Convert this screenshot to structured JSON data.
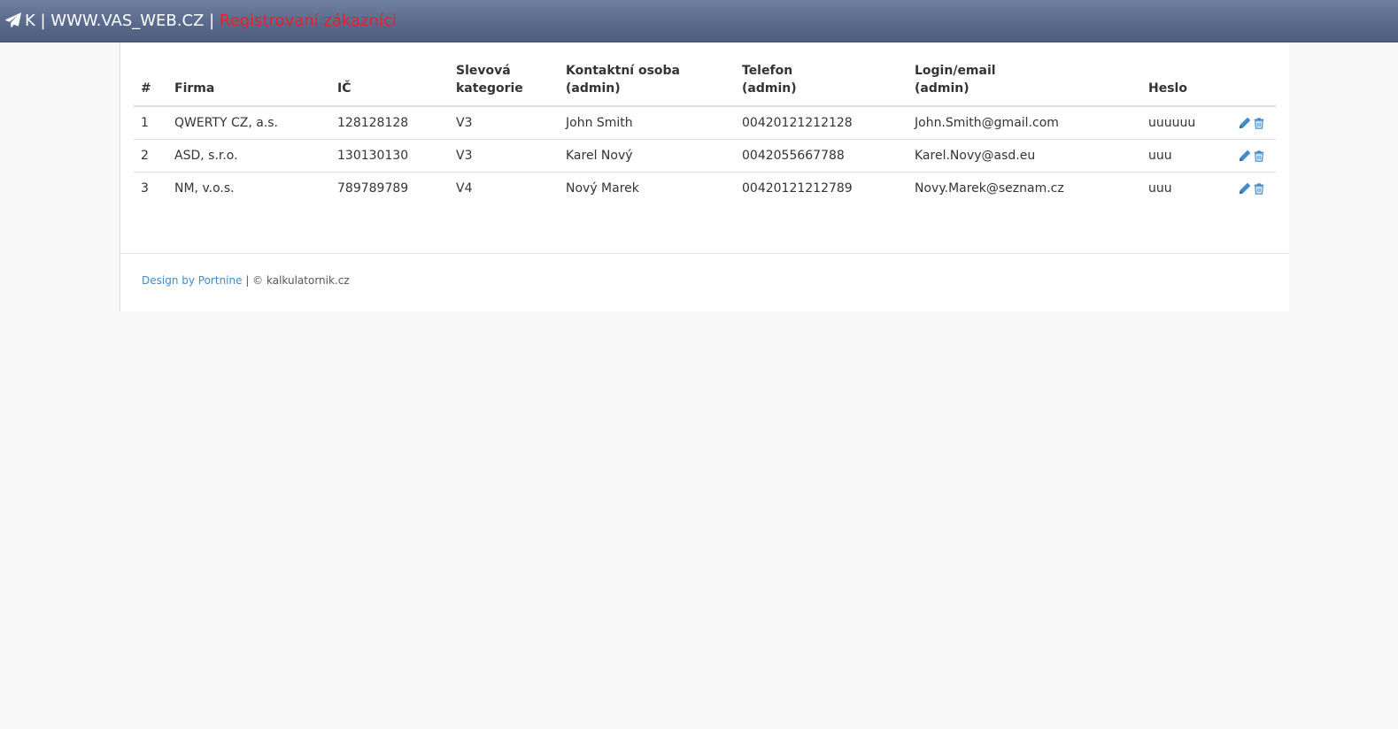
{
  "header": {
    "brand_icon": "paper-plane-icon",
    "brand_prefix": "K | WWW.VAS_WEB.CZ | ",
    "page_title": "Registrovaní zákazníci",
    "page_title_color": "#e8202a"
  },
  "table": {
    "headers": {
      "num": "#",
      "firma": "Firma",
      "ic": "IČ",
      "kategorie_1": "Slevová",
      "kategorie_2": "kategorie",
      "kontakt_1": "Kontaktní osoba",
      "kontakt_2": "(admin)",
      "telefon_1": "Telefon",
      "telefon_2": "(admin)",
      "login_1": "Login/email",
      "login_2": "(admin)",
      "heslo": "Heslo"
    },
    "rows": [
      {
        "num": "1",
        "firma": "QWERTY CZ, a.s.",
        "ic": "128128128",
        "kategorie": "V3",
        "kontakt": "John Smith",
        "telefon": "00420121212128",
        "login": "John.Smith@gmail.com",
        "heslo": "uuuuuu"
      },
      {
        "num": "2",
        "firma": "ASD, s.r.o.",
        "ic": "130130130",
        "kategorie": "V3",
        "kontakt": "Karel Nový",
        "telefon": "0042055667788",
        "login": "Karel.Novy@asd.eu",
        "heslo": "uuu"
      },
      {
        "num": "3",
        "firma": "NM, v.o.s.",
        "ic": "789789789",
        "kategorie": "V4",
        "kontakt": "Nový Marek",
        "telefon": "00420121212789",
        "login": "Novy.Marek@seznam.cz",
        "heslo": "uuu"
      }
    ],
    "action_icons": [
      "pencil-icon",
      "trash-icon"
    ],
    "icon_color": "#428bca"
  },
  "footer": {
    "design_link": "Design by Portnine",
    "separator": " | ",
    "copyright": "© kalkulatornik.cz"
  }
}
